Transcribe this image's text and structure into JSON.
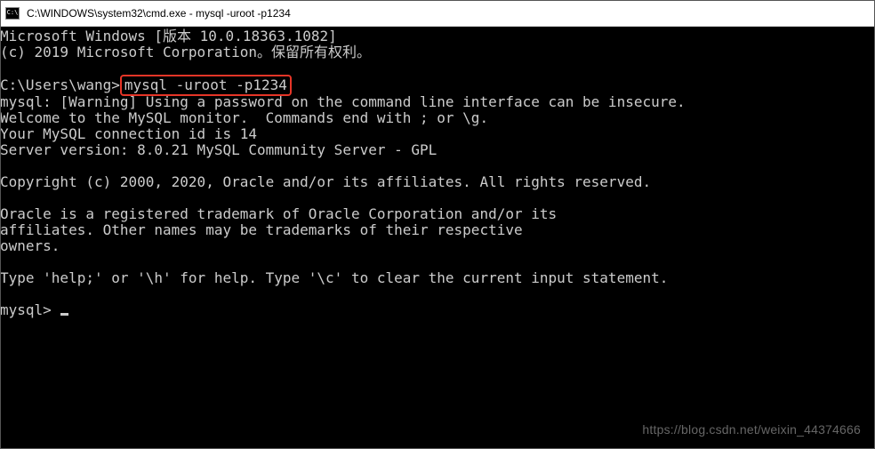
{
  "window": {
    "title": "C:\\WINDOWS\\system32\\cmd.exe - mysql  -uroot -p1234"
  },
  "terminal": {
    "line_winver": "Microsoft Windows [版本 10.0.18363.1082]",
    "line_copyright_ms": "(c) 2019 Microsoft Corporation。保留所有权利。",
    "prompt_path": "C:\\Users\\wang>",
    "command": "mysql -uroot -p1234",
    "line_warning": "mysql: [Warning] Using a password on the command line interface can be insecure.",
    "line_welcome": "Welcome to the MySQL monitor.  Commands end with ; or \\g.",
    "line_connid": "Your MySQL connection id is 14",
    "line_server": "Server version: 8.0.21 MySQL Community Server - GPL",
    "line_oracle_copy": "Copyright (c) 2000, 2020, Oracle and/or its affiliates. All rights reserved.",
    "line_trademark1": "Oracle is a registered trademark of Oracle Corporation and/or its",
    "line_trademark2": "affiliates. Other names may be trademarks of their respective",
    "line_trademark3": "owners.",
    "line_help": "Type 'help;' or '\\h' for help. Type '\\c' to clear the current input statement.",
    "mysql_prompt": "mysql> "
  },
  "watermark": "https://blog.csdn.net/weixin_44374666"
}
